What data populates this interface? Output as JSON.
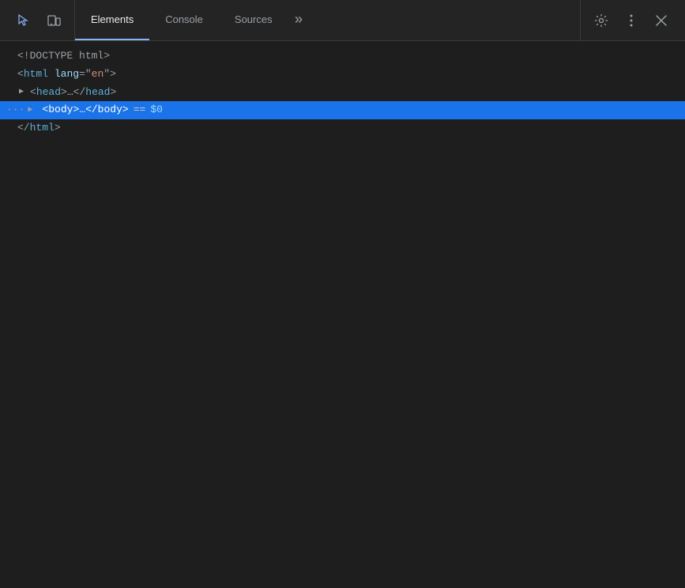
{
  "header": {
    "tabs": [
      {
        "id": "elements",
        "label": "Elements",
        "active": true
      },
      {
        "id": "console",
        "label": "Console",
        "active": false
      },
      {
        "id": "sources",
        "label": "Sources",
        "active": false
      }
    ],
    "more_tabs_label": "»",
    "settings_icon": "⚙",
    "more_options_icon": "⋮",
    "close_icon": "✕"
  },
  "left_icons": [
    {
      "id": "inspect",
      "symbol": "⬚",
      "active": true
    },
    {
      "id": "device",
      "symbol": "▭",
      "active": false
    }
  ],
  "dom": {
    "lines": [
      {
        "id": "doctype",
        "indent": 0,
        "has_expander": false,
        "dots": false,
        "content": "<!DOCTYPE html>"
      },
      {
        "id": "html-open",
        "indent": 0,
        "has_expander": false,
        "dots": false,
        "content": "<html lang=\"en\">"
      },
      {
        "id": "head",
        "indent": 1,
        "has_expander": true,
        "collapsed": true,
        "dots": false,
        "content": "<head>…</head>"
      },
      {
        "id": "body",
        "indent": 1,
        "has_expander": true,
        "collapsed": true,
        "dots": true,
        "selected": true,
        "content": "<body>…</body>",
        "suffix": "== $0"
      },
      {
        "id": "html-close",
        "indent": 0,
        "has_expander": false,
        "dots": false,
        "content": "</html>"
      }
    ]
  }
}
